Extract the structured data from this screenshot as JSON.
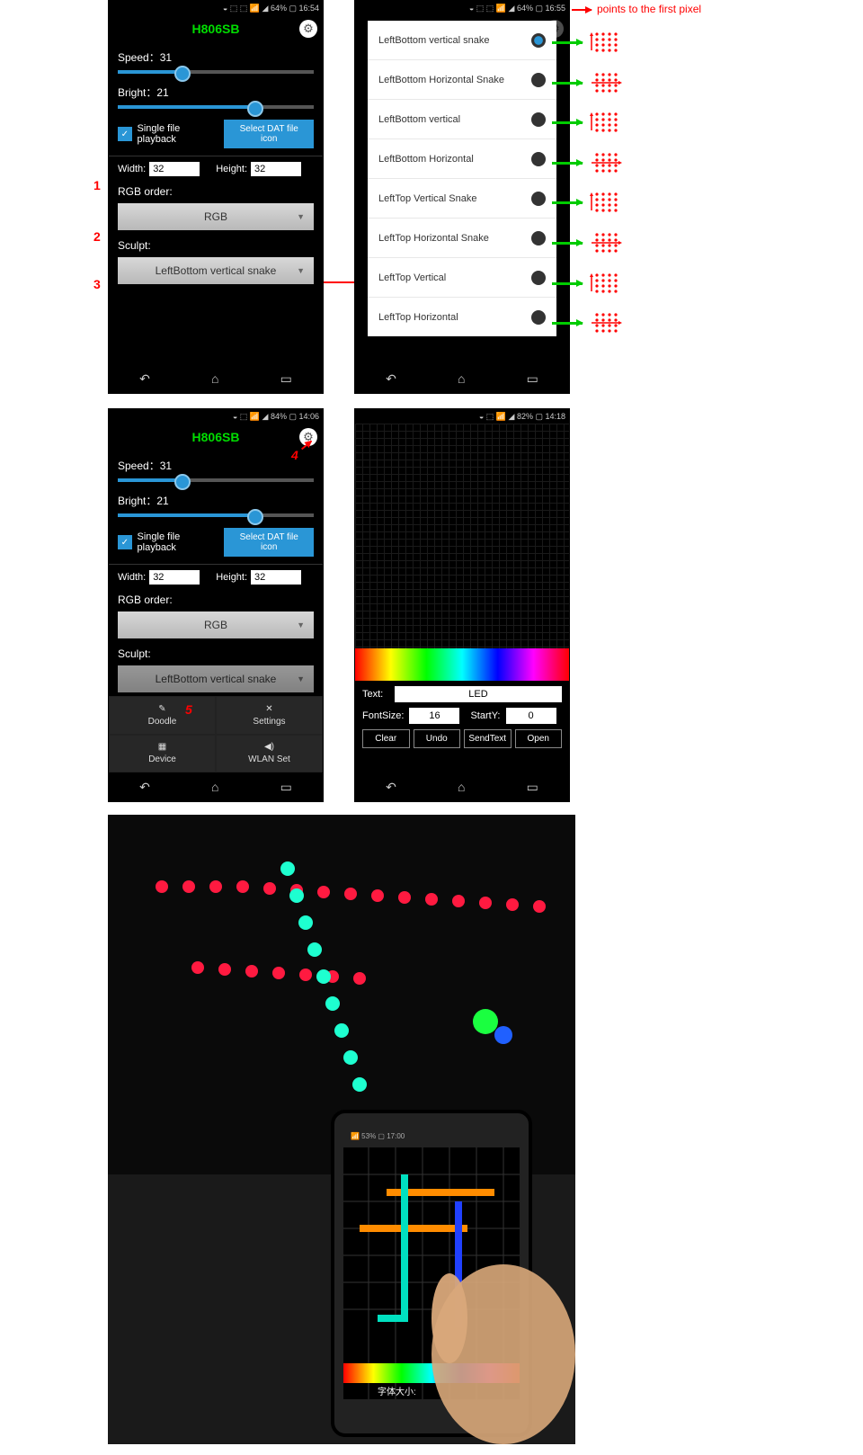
{
  "annotations": {
    "first_pixel": "points to the first pixel",
    "n1": "1",
    "n2": "2",
    "n3": "3",
    "n4": "4",
    "n5": "5"
  },
  "status": {
    "t1": "64% ▢ 16:54",
    "t2": "64% ▢ 16:55",
    "t3": "84% ▢ 14:06",
    "t4": "82% ▢ 14:18"
  },
  "app": {
    "title": "H806SB"
  },
  "main": {
    "speed_label": "Speed：31",
    "bright_label": "Bright：21",
    "single_file": "Single file playback",
    "select_dat": "Select DAT file icon",
    "width_label": "Width:",
    "width_val": "32",
    "height_label": "Height:",
    "height_val": "32",
    "rgb_order_label": "RGB order:",
    "rgb_value": "RGB",
    "sculpt_label": "Sculpt:",
    "sculpt_value": "LeftBottom vertical snake",
    "sculpt_value_cut": "LeftBottom vertical snake"
  },
  "sculpt_options": [
    "LeftBottom vertical snake",
    "LeftBottom Horizontal Snake",
    "LeftBottom vertical",
    "LeftBottom Horizontal",
    "LeftTop Vertical Snake",
    "LeftTop Horizontal Snake",
    "LeftTop Vertical",
    "LeftTop Horizontal"
  ],
  "menu": {
    "doodle": "Doodle",
    "settings": "Settings",
    "device": "Device",
    "wlan": "WLAN Set"
  },
  "doodle": {
    "text_label": "Text:",
    "text_val": "LED",
    "fontsize_label": "FontSize:",
    "fontsize_val": "16",
    "starty_label": "StartY:",
    "starty_val": "0",
    "clear": "Clear",
    "undo": "Undo",
    "sendtext": "SendText",
    "open": "Open"
  }
}
